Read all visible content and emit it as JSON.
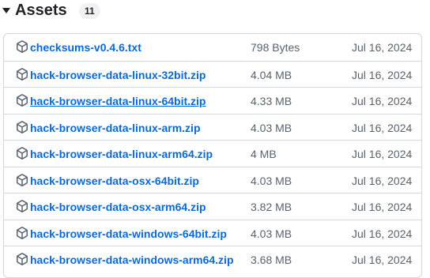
{
  "assets": {
    "title": "Assets",
    "count": "11",
    "items": [
      {
        "name": "checksums-v0.4.6.txt",
        "size": "798 Bytes",
        "date": "Jul 16, 2024",
        "icon": "package-icon"
      },
      {
        "name": "hack-browser-data-linux-32bit.zip",
        "size": "4.04 MB",
        "date": "Jul 16, 2024",
        "icon": "package-icon"
      },
      {
        "name": "hack-browser-data-linux-64bit.zip",
        "size": "4.33 MB",
        "date": "Jul 16, 2024",
        "icon": "package-icon"
      },
      {
        "name": "hack-browser-data-linux-arm.zip",
        "size": "4.03 MB",
        "date": "Jul 16, 2024",
        "icon": "package-icon"
      },
      {
        "name": "hack-browser-data-linux-arm64.zip",
        "size": "4 MB",
        "date": "Jul 16, 2024",
        "icon": "package-icon"
      },
      {
        "name": "hack-browser-data-osx-64bit.zip",
        "size": "4.03 MB",
        "date": "Jul 16, 2024",
        "icon": "package-icon"
      },
      {
        "name": "hack-browser-data-osx-arm64.zip",
        "size": "3.82 MB",
        "date": "Jul 16, 2024",
        "icon": "package-icon"
      },
      {
        "name": "hack-browser-data-windows-64bit.zip",
        "size": "4.03 MB",
        "date": "Jul 16, 2024",
        "icon": "package-icon"
      },
      {
        "name": "hack-browser-data-windows-arm64.zip",
        "size": "3.68 MB",
        "date": "Jul 16, 2024",
        "icon": "package-icon"
      }
    ]
  },
  "colors": {
    "link": "#0969da",
    "muted": "#59636e",
    "border": "#d1d9e0"
  }
}
